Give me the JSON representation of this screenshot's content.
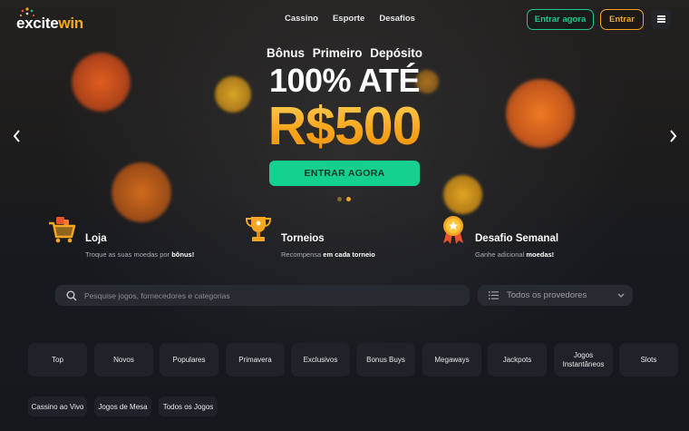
{
  "brand": {
    "logo_prefix": "e",
    "logo_mid": "xcite",
    "logo_suffix": "win"
  },
  "nav": {
    "items": [
      "Cassino",
      "Esporte",
      "Desafios"
    ]
  },
  "header": {
    "register_label": "Entrar agora",
    "login_label": "Entrar",
    "menu_icon": "hamburger-icon"
  },
  "hero": {
    "subtitle": "Bônus Primeiro Depósito",
    "headline": "100% ATÉ",
    "amount": "R$500",
    "cta_label": "ENTRAR AGORA",
    "prev_icon": "chevron-left-icon",
    "next_icon": "chevron-right-icon",
    "slide_count": 2,
    "active_slide": 2
  },
  "features": [
    {
      "title": "Loja",
      "desc_prefix": "Troque as suas moedas por",
      "desc_bold": "bônus!",
      "icon": "shopping-cart-icon"
    },
    {
      "title": "Torneios",
      "desc_prefix": "Recompensa",
      "desc_bold": "em cada torneio",
      "icon": "trophy-icon"
    },
    {
      "title": "Desafio Semanal",
      "desc_prefix": "Ganhe adicional",
      "desc_bold": "moedas!",
      "icon": "medal-icon"
    }
  ],
  "search": {
    "placeholder": "Pesquise jogos, fornecedores e categorias",
    "icon": "search-icon"
  },
  "provider_select": {
    "value": "Todos os provedores",
    "icon": "list-icon",
    "chevron": "chevron-down-icon"
  },
  "categories_row1": [
    "Top",
    "Novos",
    "Populares",
    "Primavera",
    "Exclusivos",
    "Bonus Buys",
    "Megaways",
    "Jackpots",
    "Jogos Instantâneos",
    "Slots"
  ],
  "categories_row2": [
    "Cassino ao Vivo",
    "Jogos de Mesa",
    "Todos os Jogos"
  ],
  "colors": {
    "accent_green": "#14d08f",
    "accent_orange": "#f5a623",
    "background": "#16191f"
  }
}
